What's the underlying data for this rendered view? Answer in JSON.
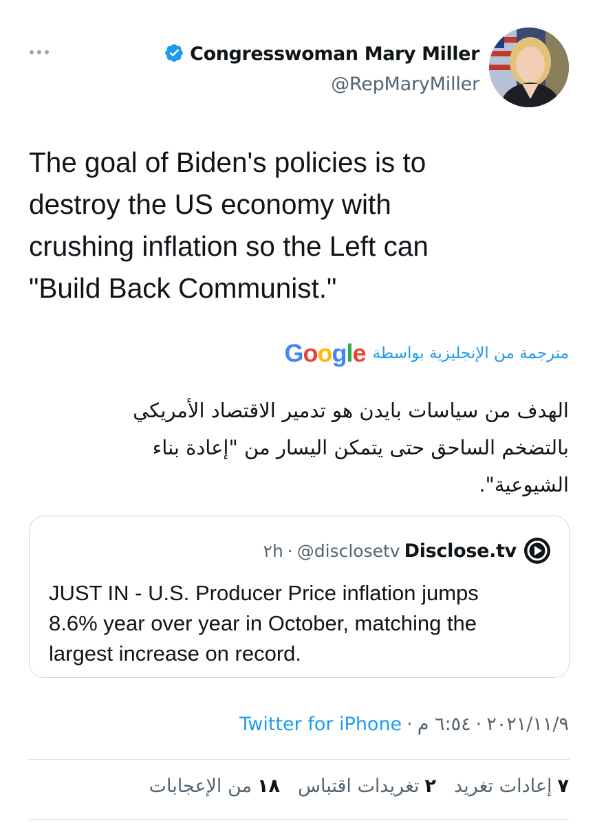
{
  "author": {
    "display_name": "Congresswoman Mary Miller",
    "handle": "@RepMaryMiller",
    "verified_icon": "verified-badge-icon",
    "avatar": "profile-photo"
  },
  "tweet": {
    "text": "The goal of Biden's policies is to\ndestroy the US economy with\ncrushing inflation so the Left can\n\"Build Back Communist.\""
  },
  "translation": {
    "label": "مترجمة من الإنجليزية بواسطة",
    "provider_letters": [
      "G",
      "o",
      "o",
      "g",
      "l",
      "e"
    ],
    "provider_colors": [
      "#4285F4",
      "#EA4335",
      "#FBBC05",
      "#4285F4",
      "#34A853",
      "#EA4335"
    ],
    "text": "الهدف من سياسات بايدن هو تدمير الاقتصاد الأمريكي\nبالتضخم الساحق حتى يتمكن اليسار من \"إعادة بناء\nالشيوعية\"."
  },
  "quoted_tweet": {
    "author_name": "Disclose.tv",
    "handle": "@disclosetv",
    "separator": "·",
    "time": "٢h",
    "text": "JUST IN - U.S. Producer Price inflation jumps\n8.6% year over year in October, matching the\nlargest increase on record."
  },
  "meta": {
    "date": "٢٠٢١/١١/٩",
    "separator": "·",
    "time": "٦:٥٤ م",
    "source": "Twitter for iPhone"
  },
  "stats": {
    "retweets_count": "٧",
    "retweets_label": "إعادات تغريد",
    "quotes_count": "٢",
    "quotes_label": "تغريدات اقتباس",
    "likes_count": "١٨",
    "likes_label": "من الإعجابات"
  },
  "colors": {
    "accent": "#1d9bf0",
    "secondary_text": "#536471",
    "border": "#cfd9de"
  }
}
